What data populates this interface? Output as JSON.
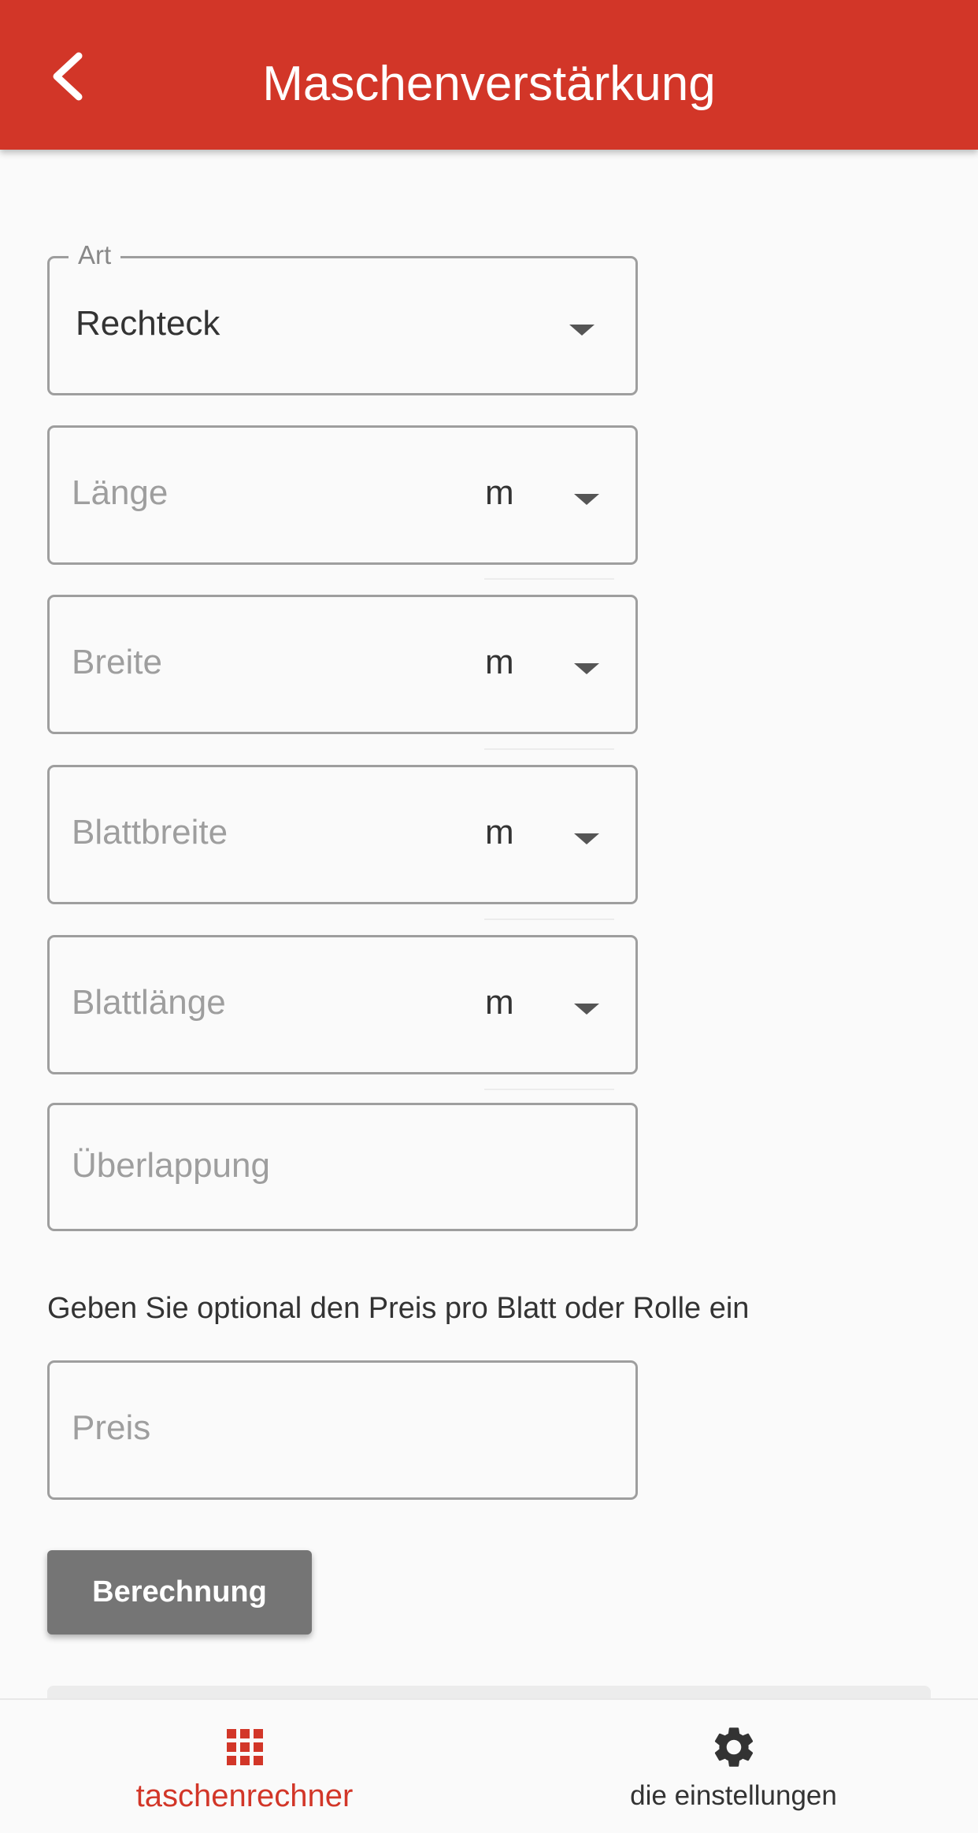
{
  "app_bar": {
    "title": "Maschenverstärkung",
    "back_icon": "chevron-left-icon",
    "background": "#d23628"
  },
  "form": {
    "art": {
      "label": "Art",
      "value": "Rechteck"
    },
    "laenge": {
      "placeholder": "Länge",
      "unit": "m"
    },
    "breite": {
      "placeholder": "Breite",
      "unit": "m"
    },
    "blattbreite": {
      "placeholder": "Blattbreite",
      "unit": "m"
    },
    "blattlaenge": {
      "placeholder": "Blattlänge",
      "unit": "m"
    },
    "ueberlappung": {
      "placeholder": "Überlappung"
    },
    "price_hint": "Geben Sie optional den Preis pro Blatt oder Rolle ein",
    "preis": {
      "placeholder": "Preis"
    },
    "calculate_label": "Berechnung"
  },
  "bottom_nav": {
    "items": [
      {
        "label": "taschenrechner",
        "icon": "grid-icon",
        "active": true,
        "color": "#d23628"
      },
      {
        "label": "die einstellungen",
        "icon": "gear-icon",
        "active": false,
        "color": "#333333"
      }
    ]
  }
}
